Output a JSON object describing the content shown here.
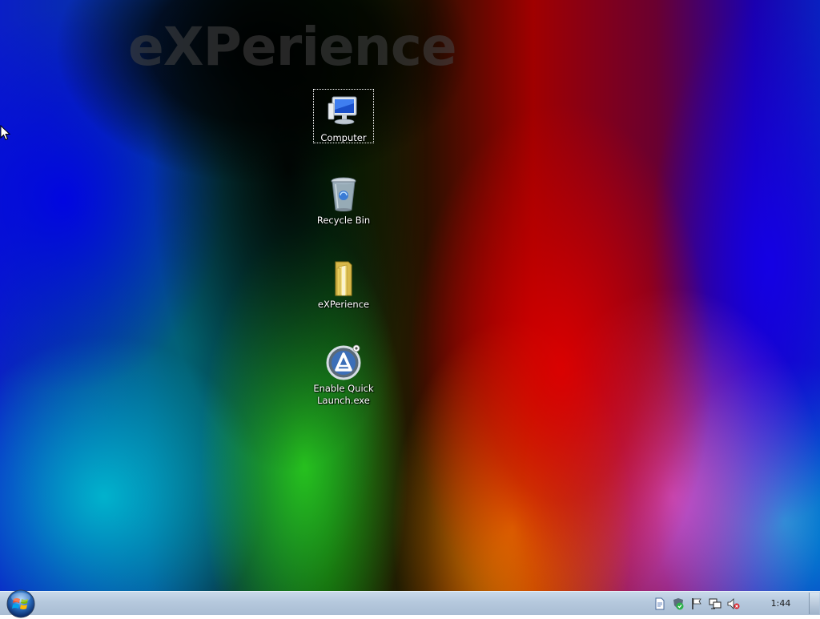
{
  "desktop": {
    "watermark_text": "eXPerience",
    "icons": [
      {
        "label": "Computer",
        "icon": "computer-icon",
        "selected": true
      },
      {
        "label": "Recycle Bin",
        "icon": "recycle-bin-icon",
        "selected": false
      },
      {
        "label": "eXPerience",
        "icon": "folder-icon",
        "selected": false
      },
      {
        "label": "Enable Quick Launch.exe",
        "icon": "app-a-icon",
        "selected": false
      }
    ]
  },
  "taskbar": {
    "start_button_icon": "windows-logo-icon",
    "tray_icons": [
      "document-icon",
      "security-shield-icon",
      "action-center-flag-icon",
      "network-icon",
      "volume-muted-icon"
    ],
    "clock": "1:44"
  },
  "colors": {
    "taskbar_top": "#c9d9ea",
    "taskbar_bottom": "#a9bdd3",
    "icon_label_text": "#ffffff"
  }
}
